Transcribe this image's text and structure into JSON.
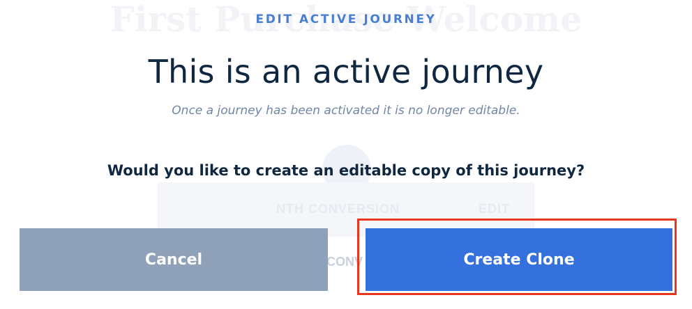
{
  "background": {
    "page_title": "First Purchase Welcome",
    "card_label": "NTH CONVERSION",
    "card_action": "EDIT",
    "card_subtext": "CONV"
  },
  "modal": {
    "eyebrow": "EDIT ACTIVE JOURNEY",
    "headline": "This is an active journey",
    "subtext": "Once a journey has been activated it is no longer editable.",
    "question": "Would you like to create an editable copy of this journey?",
    "cancel_label": "Cancel",
    "clone_label": "Create Clone"
  },
  "colors": {
    "accent": "#3571dd",
    "cancel": "#8fa1b9",
    "eyebrow": "#4a7ed3",
    "heading": "#0f2740",
    "highlight": "#e8351d"
  }
}
